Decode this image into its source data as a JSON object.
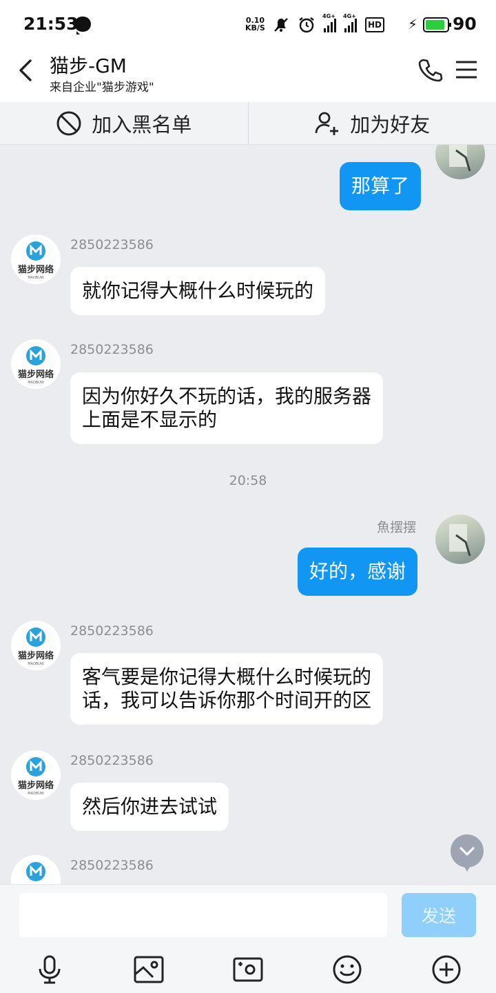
{
  "status_bar": {
    "time": "21:53",
    "net_speed_value": "0.10",
    "net_speed_unit": "KB/S",
    "signal_tag": "4G+",
    "hd_label": "HD",
    "battery_level": "90"
  },
  "header": {
    "title": "猫步-GM",
    "subtitle": "来自企业\"猫步游戏\""
  },
  "actions": {
    "block_label": "加入黑名单",
    "add_friend_label": "加为好友"
  },
  "messages": [
    {
      "text": "那算了"
    },
    {
      "sender": "2850223586",
      "text": "就你记得大概什么时候玩的"
    },
    {
      "sender": "2850223586",
      "text_lines": [
        "因为你好久不玩的话，我的服务器",
        "上面是不显示的"
      ]
    },
    {
      "timestamp": "20:58"
    },
    {
      "sender": "魚摆摆",
      "text": "好的，感谢"
    },
    {
      "sender": "2850223586",
      "text_lines": [
        "客气要是你记得大概什么时候玩的",
        "话，我可以告诉你那个时间开的区"
      ]
    },
    {
      "sender": "2850223586",
      "text": "然后你进去试试"
    },
    {
      "sender": "2850223586"
    }
  ],
  "gm_avatar": {
    "brand_text": "猫步网络",
    "brand_subtext": "MAOBUW"
  },
  "input": {
    "value": "",
    "send_label": "发送"
  },
  "icons": [
    "back-icon",
    "phone-icon",
    "menu-icon",
    "block-icon",
    "add-friend-icon",
    "scroll-down-icon",
    "microphone-icon",
    "image-icon",
    "camera-icon",
    "emoji-icon",
    "plus-icon"
  ],
  "colors": {
    "accent": "#1296f3",
    "send_disabled": "#8fcff9",
    "chat_bg": "#ebecf0"
  }
}
